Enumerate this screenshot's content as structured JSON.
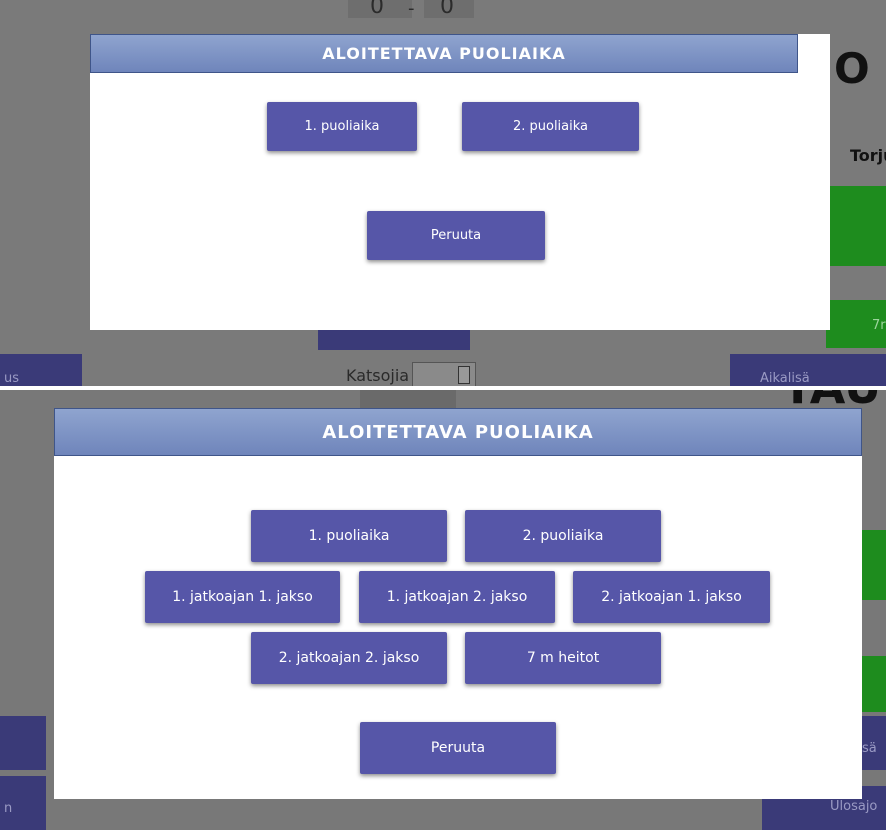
{
  "panel1": {
    "background": {
      "score_home": "0",
      "score_separator": "-",
      "score_away": "0",
      "title_fragment": "O I",
      "side_label": "Torju",
      "small_button_label": "7r",
      "left_button_label": "us",
      "spectators_label": "Katsojia",
      "timeout_button_label": "Aikalisä"
    },
    "modal": {
      "title": "ALOITETTAVA PUOLIAIKA",
      "buttons": [
        "1. puoliaika",
        "2. puoliaika"
      ],
      "cancel_label": "Peruuta"
    }
  },
  "panel2": {
    "background": {
      "title_fragment": "TAU",
      "left_button_label": "n",
      "right_button_label_top": "sä",
      "right_button_label_bottom": "Ulosajo"
    },
    "modal": {
      "title": "ALOITETTAVA PUOLIAIKA",
      "buttons": [
        "1. puoliaika",
        "2. puoliaika",
        "1. jatkoajan 1. jakso",
        "1. jatkoajan 2. jakso",
        "2. jatkoajan 1. jakso",
        "2. jatkoajan 2. jakso",
        "7 m heitot"
      ],
      "cancel_label": "Peruuta"
    }
  },
  "colors": {
    "button": "#5656a8",
    "header_gradient_top": "#8fa4cf",
    "header_gradient_bottom": "#6f85bb",
    "overlay": "#7a7a7a",
    "dim_green": "#1e8c1e"
  }
}
